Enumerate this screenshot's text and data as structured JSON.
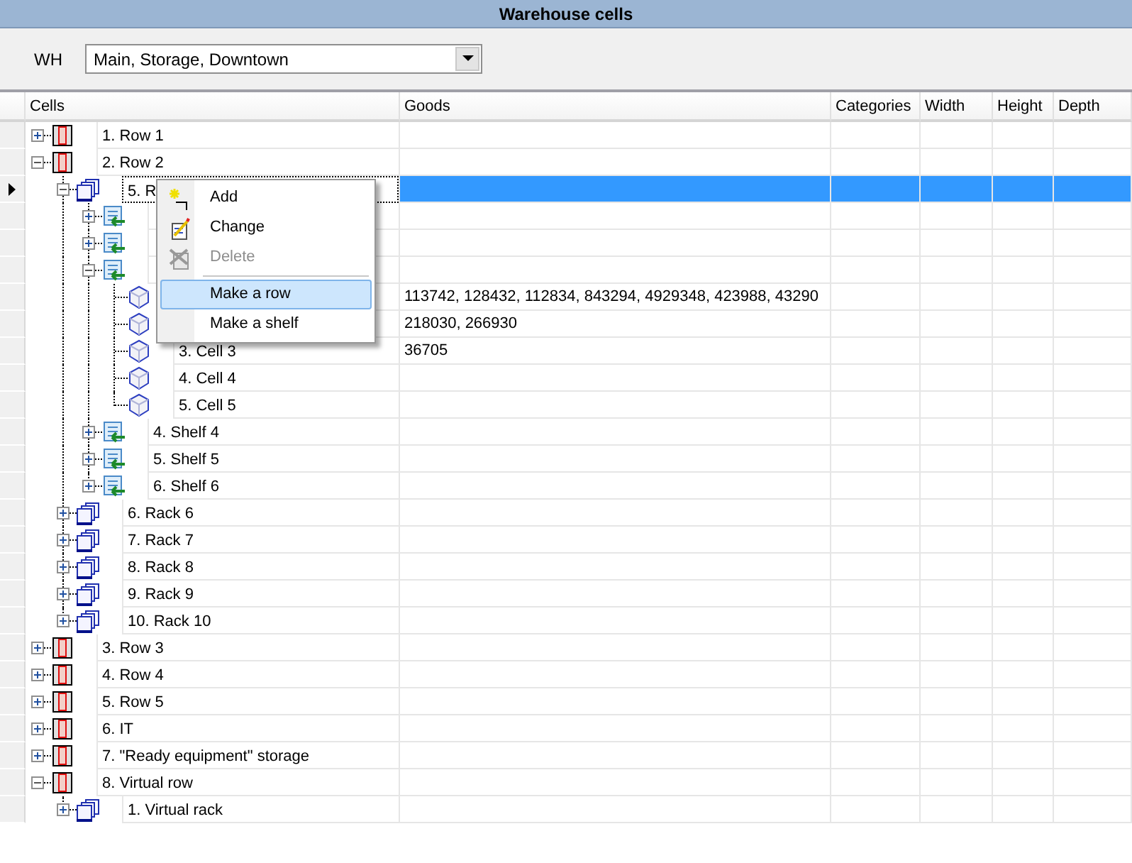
{
  "window": {
    "title": "Warehouse cells"
  },
  "warehouse": {
    "label": "WH",
    "value": "Main, Storage, Downtown"
  },
  "columns": [
    "Cells",
    "Goods",
    "Categories",
    "Width",
    "Height",
    "Depth"
  ],
  "tree": [
    {
      "kind": "row",
      "label": "1. Row 1",
      "expanded": false,
      "selected": false
    },
    {
      "kind": "row",
      "label": "2. Row 2",
      "expanded": true,
      "selected": false,
      "children": [
        {
          "kind": "rack",
          "label": "5. R",
          "expanded": true,
          "selected": true,
          "children": [
            {
              "kind": "shelf",
              "expanded": false,
              "selected": false
            },
            {
              "kind": "shelf",
              "expanded": false,
              "selected": false
            },
            {
              "kind": "shelf",
              "expanded": true,
              "selected": false,
              "children": [
                {
                  "kind": "cell",
                  "goods": "113742, 128432, 112834, 843294, 4929348, 423988, 43290",
                  "selected": false
                },
                {
                  "kind": "cell",
                  "goods": "218030, 266930",
                  "selected": false
                },
                {
                  "kind": "cell",
                  "label": "3. Cell 3",
                  "goods": "36705",
                  "selected": false
                },
                {
                  "kind": "cell",
                  "label": "4. Cell 4",
                  "selected": false
                },
                {
                  "kind": "cell",
                  "label": "5. Cell 5",
                  "selected": false
                }
              ]
            },
            {
              "kind": "shelf",
              "label": "4. Shelf 4",
              "expanded": false,
              "selected": false
            },
            {
              "kind": "shelf",
              "label": "5. Shelf 5",
              "expanded": false,
              "selected": false
            },
            {
              "kind": "shelf",
              "label": "6. Shelf 6",
              "expanded": false,
              "selected": false
            }
          ]
        },
        {
          "kind": "rack",
          "label": "6. Rack 6",
          "expanded": false,
          "selected": false
        },
        {
          "kind": "rack",
          "label": "7. Rack 7",
          "expanded": false,
          "selected": false
        },
        {
          "kind": "rack",
          "label": "8. Rack 8",
          "expanded": false,
          "selected": false
        },
        {
          "kind": "rack",
          "label": "9. Rack 9",
          "expanded": false,
          "selected": false
        },
        {
          "kind": "rack",
          "label": "10. Rack 10",
          "expanded": false,
          "selected": false
        }
      ]
    },
    {
      "kind": "row",
      "label": "3. Row 3",
      "expanded": false,
      "selected": false
    },
    {
      "kind": "row",
      "label": "4. Row 4",
      "expanded": false,
      "selected": false
    },
    {
      "kind": "row",
      "label": "5. Row 5",
      "expanded": false,
      "selected": false
    },
    {
      "kind": "row",
      "label": "6. IT",
      "expanded": false,
      "selected": false
    },
    {
      "kind": "row",
      "label": "7. \"Ready equipment\" storage",
      "expanded": false,
      "selected": false
    },
    {
      "kind": "row",
      "label": "8. Virtual row",
      "expanded": true,
      "selected": false,
      "children": [
        {
          "kind": "rack",
          "label": "1. Virtual rack",
          "expanded": false,
          "selected": false
        }
      ]
    }
  ],
  "context_menu": {
    "items": [
      {
        "kind": "command",
        "label": "Add",
        "disabled": false,
        "selected": false
      },
      {
        "kind": "command",
        "label": "Change",
        "disabled": false,
        "selected": false
      },
      {
        "kind": "command",
        "label": "Delete",
        "disabled": true,
        "selected": false
      },
      {
        "kind": "separator"
      },
      {
        "kind": "command",
        "label": "Make a row",
        "disabled": false,
        "selected": true
      },
      {
        "kind": "command",
        "label": "Make a shelf",
        "disabled": false,
        "selected": false
      }
    ]
  }
}
